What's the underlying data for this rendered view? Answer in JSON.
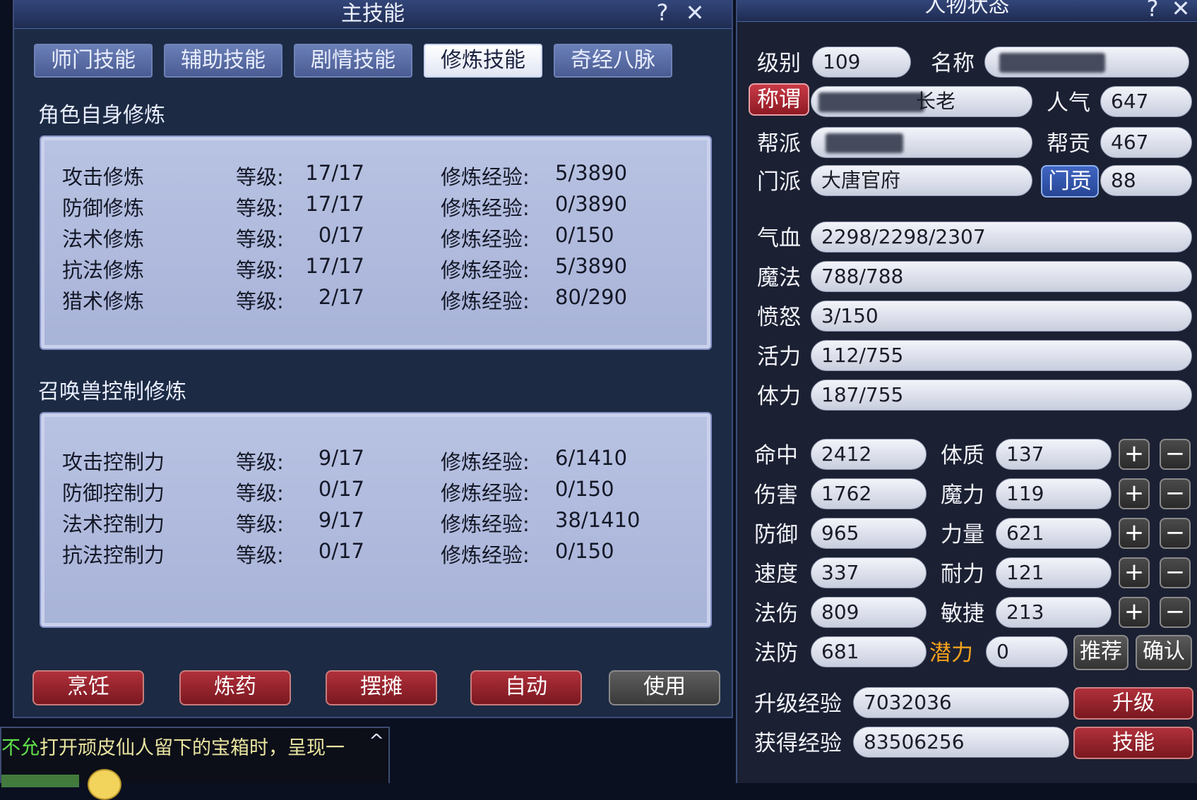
{
  "skills_window": {
    "title": "主技能",
    "help_label": "?",
    "close_label": "✕",
    "tabs": [
      "师门技能",
      "辅助技能",
      "剧情技能",
      "修炼技能",
      "奇经八脉"
    ],
    "active_tab": "修炼技能",
    "self_section": {
      "title": "角色自身修炼",
      "rows": [
        {
          "name": "攻击修炼",
          "level_label": "等级:",
          "level": "17/17",
          "exp_label": "修炼经验:",
          "exp": "5/3890"
        },
        {
          "name": "防御修炼",
          "level_label": "等级:",
          "level": "17/17",
          "exp_label": "修炼经验:",
          "exp": "0/3890"
        },
        {
          "name": "法术修炼",
          "level_label": "等级:",
          "level": "0/17",
          "exp_label": "修炼经验:",
          "exp": "0/150"
        },
        {
          "name": "抗法修炼",
          "level_label": "等级:",
          "level": "17/17",
          "exp_label": "修炼经验:",
          "exp": "5/3890"
        },
        {
          "name": "猎术修炼",
          "level_label": "等级:",
          "level": "2/17",
          "exp_label": "修炼经验:",
          "exp": "80/290"
        }
      ]
    },
    "pet_section": {
      "title": "召唤兽控制修炼",
      "rows": [
        {
          "name": "攻击控制力",
          "level_label": "等级:",
          "level": "9/17",
          "exp_label": "修炼经验:",
          "exp": "6/1410"
        },
        {
          "name": "防御控制力",
          "level_label": "等级:",
          "level": "0/17",
          "exp_label": "修炼经验:",
          "exp": "0/150"
        },
        {
          "name": "法术控制力",
          "level_label": "等级:",
          "level": "9/17",
          "exp_label": "修炼经验:",
          "exp": "38/1410"
        },
        {
          "name": "抗法控制力",
          "level_label": "等级:",
          "level": "0/17",
          "exp_label": "修炼经验:",
          "exp": "0/150"
        }
      ]
    },
    "buttons": {
      "cook": "烹饪",
      "alchemy": "炼药",
      "stall": "摆摊",
      "auto": "自动",
      "use": "使用"
    }
  },
  "chat": {
    "prefix": "不允",
    "text": "打开顽皮仙人留下的宝箱时，呈现一",
    "scroll_up": "^"
  },
  "status_window": {
    "title": "人物状态",
    "help_label": "?",
    "close_label": "✕",
    "level_label": "级别",
    "level": "109",
    "name_label": "名称",
    "name": "",
    "title_badge": "称谓",
    "char_title": "长老",
    "popularity_label": "人气",
    "popularity": "647",
    "guild_label": "帮派",
    "guild": "",
    "guild_contrib_label": "帮贡",
    "guild_contrib": "467",
    "sect_label": "门派",
    "sect": "大唐官府",
    "sect_contrib_badge": "门贡",
    "sect_contrib": "88",
    "vitals": [
      {
        "label": "气血",
        "value": "2298/2298/2307"
      },
      {
        "label": "魔法",
        "value": "788/788"
      },
      {
        "label": "愤怒",
        "value": "3/150"
      },
      {
        "label": "活力",
        "value": "112/755"
      },
      {
        "label": "体力",
        "value": "187/755"
      }
    ],
    "combat_stats": [
      {
        "label": "命中",
        "value": "2412"
      },
      {
        "label": "伤害",
        "value": "1762"
      },
      {
        "label": "防御",
        "value": "965"
      },
      {
        "label": "速度",
        "value": "337"
      },
      {
        "label": "法伤",
        "value": "809"
      },
      {
        "label": "法防",
        "value": "681"
      }
    ],
    "attributes": [
      {
        "label": "体质",
        "value": "137"
      },
      {
        "label": "魔力",
        "value": "119"
      },
      {
        "label": "力量",
        "value": "621"
      },
      {
        "label": "耐力",
        "value": "121"
      },
      {
        "label": "敏捷",
        "value": "213"
      }
    ],
    "plus_label": "+",
    "minus_label": "−",
    "potential_label": "潜力",
    "potential": "0",
    "recommend_label": "推荐",
    "confirm_label": "确认",
    "upgrade_exp_label": "升级经验",
    "upgrade_exp": "7032036",
    "gained_exp_label": "获得经验",
    "gained_exp": "83506256",
    "levelup_label": "升级",
    "skills_label": "技能"
  }
}
